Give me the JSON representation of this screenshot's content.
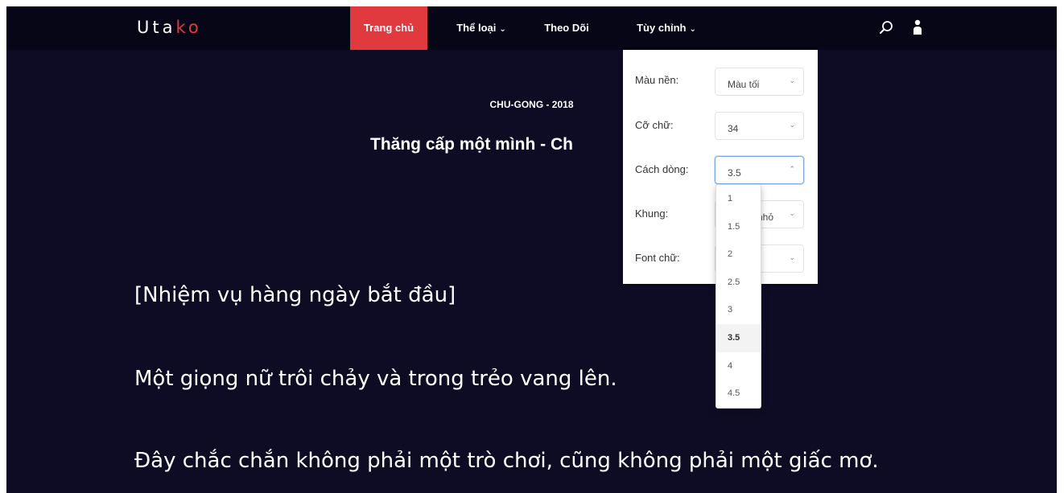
{
  "logo": {
    "part1": "Uta",
    "part2": "k",
    "part3": "o"
  },
  "nav": {
    "home": "Trang chủ",
    "genre": "Thể loại",
    "follow": "Theo Dõi",
    "custom": "Tùy chỉnh"
  },
  "chapter": {
    "meta": "CHU-GONG - 2018",
    "title": "Thăng cấp một mình - Ch"
  },
  "content": [
    "[Nhiệm vụ hàng ngày bắt đầu]",
    "Một giọng nữ trôi chảy và trong trẻo vang lên.",
    "Đây chắc chắn không phải một trò chơi, cũng không phải một giấc mơ."
  ],
  "settings": {
    "background": {
      "label": "Màu nền:",
      "value": "Màu tối"
    },
    "font_size": {
      "label": "Cỡ chữ:",
      "value": "34"
    },
    "line_height": {
      "label": "Cách dòng:",
      "value": "3.5"
    },
    "frame": {
      "label": "Khung:",
      "value": "nhỏ"
    },
    "font": {
      "label": "Font chữ:",
      "value": ""
    }
  },
  "line_height_options": [
    "1",
    "1.5",
    "2",
    "2.5",
    "3",
    "3.5",
    "4",
    "4.5"
  ],
  "icons": {
    "search": "search-icon",
    "user": "user-icon",
    "chevron": "chevron-down-icon"
  },
  "colors": {
    "accent": "#e03a3e",
    "background": "#0d0c24",
    "navbar": "#070617"
  }
}
